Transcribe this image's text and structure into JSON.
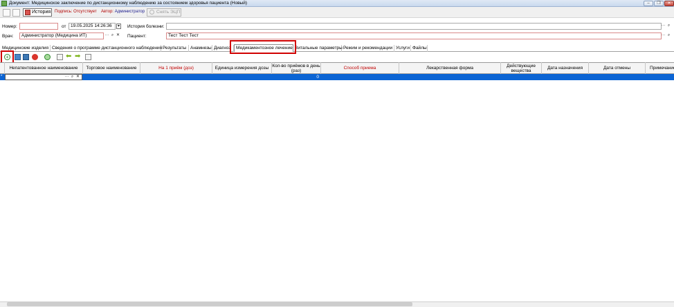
{
  "window": {
    "title": "Документ: Медицинское заключение по дистанционному наблюдению за состоянием здоровья пациента (Новый)"
  },
  "toolbar": {
    "history_label": "История",
    "sign_label": "Подпись: Отсутствует",
    "author_label": "Автор:",
    "author_value": "Администратор",
    "remove_eds_label": "Снять ЭЦП"
  },
  "form": {
    "number_label": "Номер:",
    "number_value": "",
    "from_label": "от",
    "date_value": "19.05.2025 14:26:36",
    "history_label": "История болезни:",
    "history_value": "",
    "doctor_label": "Врач:",
    "doctor_value": "Администратор (Медицина ИТ)",
    "patient_label": "Пациент:",
    "patient_value": "Тест Тест Тест",
    "ellipsis": "···",
    "search_glyph": "🔍",
    "clear_glyph": "✕"
  },
  "tabs": [
    "Медицинские изделия",
    "Сведения о программе дистанционного наблюдения",
    "Результаты",
    "Анамнезы",
    "Диагноз",
    "Медикаментозное лечение",
    "Витальные параметры",
    "Режим и рекомендации",
    "Услуги",
    "Файлы"
  ],
  "grid": {
    "columns": [
      "Непатентованное наименование",
      "Торговое наименование",
      "На 1 приём (доз)",
      "Единица измерения дозы",
      "Кол-во приёмов в день (раз)",
      "Способ приема",
      "Лекарственная форма",
      "Действующие вещества",
      "Дата назначения",
      "Дата отмены",
      "Примечание"
    ],
    "row": {
      "marker": "*",
      "qty": "0"
    }
  },
  "colors": {
    "selection": "#0b64d4",
    "highlight": "#d00000",
    "required_border": "#d98a8a"
  }
}
